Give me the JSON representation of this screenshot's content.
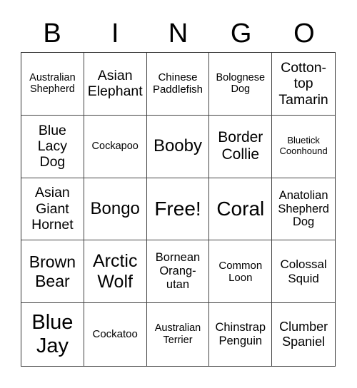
{
  "header": [
    "B",
    "I",
    "N",
    "G",
    "O"
  ],
  "cells": [
    "Australian Shepherd",
    "Asian Elephant",
    "Chinese Paddlefish",
    "Bolognese Dog",
    "Cotton-top Tamarin",
    "Blue Lacy Dog",
    "Cockapoo",
    "Booby",
    "Border Collie",
    "Bluetick Coonhound",
    "Asian Giant Hornet",
    "Bongo",
    "Free!",
    "Coral",
    "Anatolian Shepherd Dog",
    "Brown Bear",
    "Arctic Wolf",
    "Bornean Orang-utan",
    "Common Loon",
    "Colossal Squid",
    "Blue Jay",
    "Cockatoo",
    "Australian Terrier",
    "Chinstrap Penguin",
    "Clumber Spaniel"
  ]
}
